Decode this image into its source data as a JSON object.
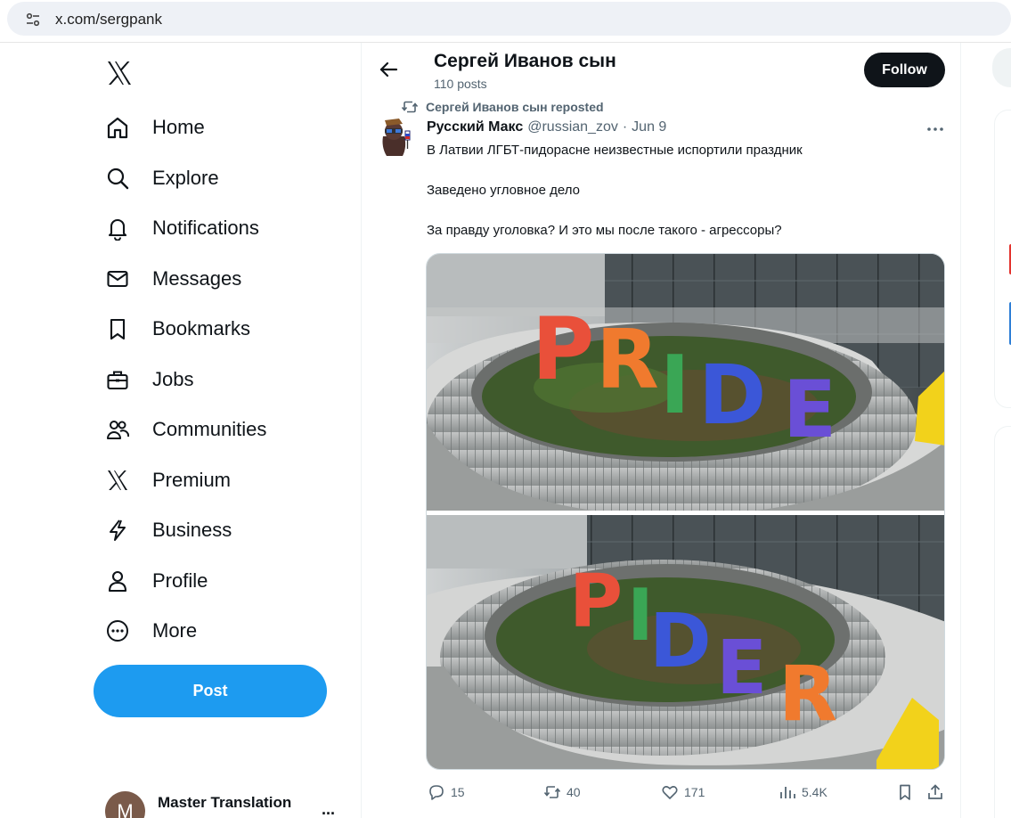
{
  "browser": {
    "url": "x.com/sergpank",
    "site_info_icon": "tune-icon"
  },
  "sidebar": {
    "logo_icon": "x-logo-icon",
    "items": [
      {
        "label": "Home",
        "icon": "home-icon"
      },
      {
        "label": "Explore",
        "icon": "search-icon"
      },
      {
        "label": "Notifications",
        "icon": "bell-icon"
      },
      {
        "label": "Messages",
        "icon": "envelope-icon"
      },
      {
        "label": "Bookmarks",
        "icon": "bookmark-icon"
      },
      {
        "label": "Jobs",
        "icon": "briefcase-icon"
      },
      {
        "label": "Communities",
        "icon": "people-icon"
      },
      {
        "label": "Premium",
        "icon": "x-logo-icon"
      },
      {
        "label": "Business",
        "icon": "lightning-icon"
      },
      {
        "label": "Profile",
        "icon": "person-icon"
      },
      {
        "label": "More",
        "icon": "more-circle-icon"
      }
    ],
    "post_button": "Post",
    "account": {
      "avatar_letter": "M",
      "name": "Master Translation",
      "more": "..."
    }
  },
  "header": {
    "profile_name": "Сергей Иванов сын",
    "post_count": "110 posts",
    "follow_button": "Follow"
  },
  "tweet": {
    "repost_label": "Сергей Иванов сын reposted",
    "author_name": "Русский Макс",
    "author_handle": "@russian_zov",
    "separator": "·",
    "date": "Jun 9",
    "lines": [
      "В Латвии ЛГБТ-пидорасне неизвестные испортили праздник",
      "Заведено угловное дело",
      "За правду уголовка? И это мы после такого  - агрессоры?"
    ],
    "media": {
      "top_letters": [
        "P",
        "R",
        "I",
        "D",
        "E"
      ],
      "bottom_letters": [
        "P",
        "I",
        "D",
        "E",
        "R"
      ],
      "letter_colors": [
        "#e9503a",
        "#f07a2e",
        "#3aa655",
        "#3b57d8",
        "#6a4fd6"
      ]
    },
    "actions": {
      "replies": "15",
      "reposts": "40",
      "likes": "171",
      "views": "5.4K"
    }
  }
}
